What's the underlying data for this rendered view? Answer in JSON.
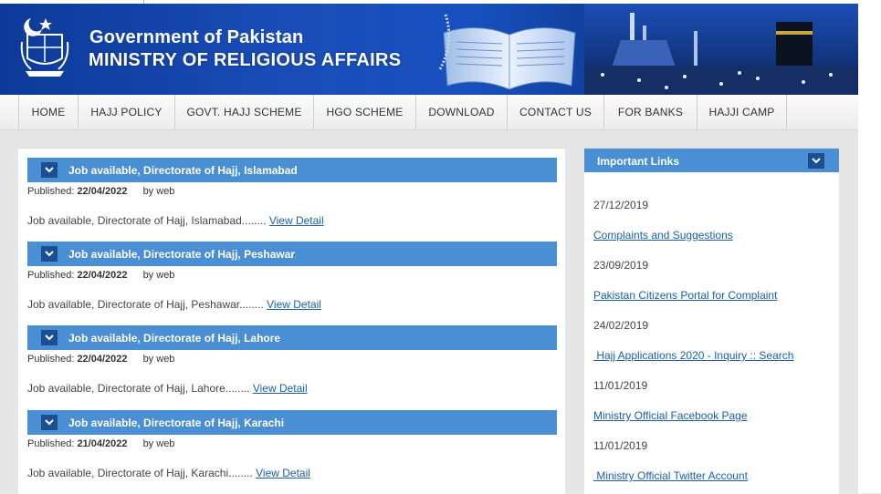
{
  "header": {
    "line1": "Government of Pakistan",
    "line2": "MINISTRY OF RELIGIOUS AFFAIRS"
  },
  "nav": [
    {
      "label": "HOME"
    },
    {
      "label": "HAJJ POLICY"
    },
    {
      "label": "GOVT. HAJJ SCHEME"
    },
    {
      "label": "HGO SCHEME"
    },
    {
      "label": "DOWNLOAD"
    },
    {
      "label": "CONTACT US"
    },
    {
      "label": "FOR BANKS"
    },
    {
      "label": "HAJJI CAMP"
    }
  ],
  "posts": [
    {
      "title": "Job available, Directorate of Hajj, Islamabad",
      "published_label": "Published:",
      "date": "22/04/2022",
      "by_label": "by",
      "author": "web",
      "excerpt": "Job available, Directorate of Hajj, Islamabad........",
      "link": "View Detail"
    },
    {
      "title": "Job available, Directorate of Hajj, Peshawar",
      "published_label": "Published:",
      "date": "22/04/2022",
      "by_label": "by",
      "author": "web",
      "excerpt": "Job available, Directorate of Hajj, Peshawar........",
      "link": "View Detail"
    },
    {
      "title": "Job available, Directorate of Hajj, Lahore",
      "published_label": "Published:",
      "date": "22/04/2022",
      "by_label": "by",
      "author": "web",
      "excerpt": "Job available, Directorate of Hajj, Lahore........",
      "link": "View Detail"
    },
    {
      "title": "Job available, Directorate of Hajj, Karachi",
      "published_label": "Published:",
      "date": "21/04/2022",
      "by_label": "by",
      "author": "web",
      "excerpt": "Job available, Directorate of Hajj, Karachi........",
      "link": "View Detail"
    }
  ],
  "sidebar": {
    "title": "Important Links",
    "items": [
      {
        "date": "27/12/2019",
        "link": "Complaints and Suggestions"
      },
      {
        "date": "23/09/2019",
        "link": "Pakistan Citizens Portal for Complaint"
      },
      {
        "date": "24/02/2019",
        "link": " Hajj Applications 2020 - Inquiry :: Search"
      },
      {
        "date": "11/01/2019",
        "link": "Ministry Official Facebook Page"
      },
      {
        "date": "11/01/2019",
        "link": " Ministry Official Twitter Account"
      }
    ]
  },
  "colors": {
    "bar_blue": "#4a8ed4",
    "arrow_box": "#1c4f92",
    "link": "#1b5faa",
    "header_blue": "#1750bf"
  }
}
